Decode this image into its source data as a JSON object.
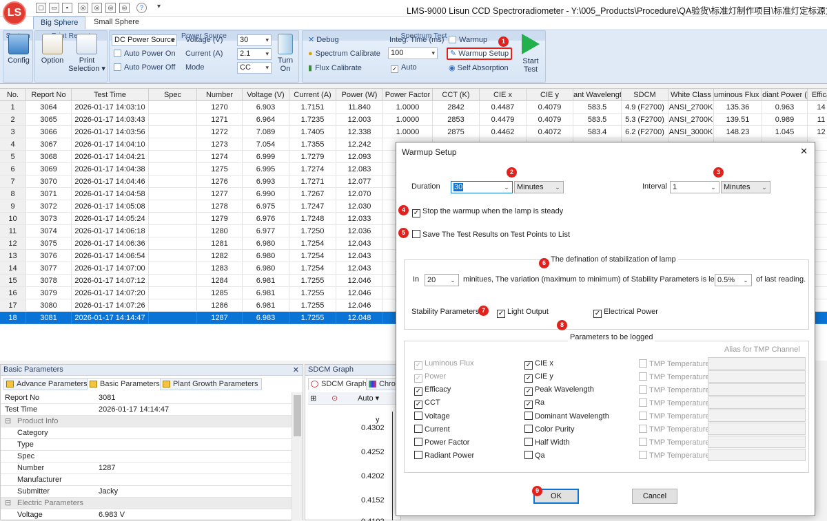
{
  "window": {
    "title": "LMS-9000 Lisun CCD Spectroradiometer - Y:\\005_Products\\Procedure\\QA验货\\标准灯制作项目\\标准灯定标源文件\\All",
    "logo_text": "LS"
  },
  "ribbon_tabs": [
    "Big Sphere",
    "Small Sphere"
  ],
  "ribbon": {
    "system": {
      "label": "System",
      "config": "Config"
    },
    "print_report": {
      "label": "Print Report",
      "option": "Option",
      "print": "Print",
      "selection": "Selection ▾"
    },
    "power_source": {
      "label": "Power Source",
      "source_select": "DC Power Source",
      "auto_on": "Auto Power On",
      "auto_off": "Auto Power Off",
      "voltage_label": "Voltage (V)",
      "voltage_value": "30",
      "current_label": "Current (A)",
      "current_value": "2.1",
      "mode_label": "Mode",
      "mode_value": "CC",
      "turn_on": "Turn",
      "turn_on2": "On"
    },
    "spectrum_test": {
      "label": "Spectrum Test",
      "debug": "Debug",
      "spectrum_calibrate": "Spectrum Calibrate",
      "flux_calibrate": "Flux Calibrate",
      "integ_label": "Integ. Time (ms)",
      "integ_value": "100",
      "auto": "Auto",
      "warmup": "Warmup",
      "warmup_setup": "Warmup Setup",
      "self_absorption": "Self Absorption",
      "start": "Start",
      "start2": "Test"
    }
  },
  "table": {
    "headers": [
      "No.",
      "Report No",
      "Test Time",
      "Spec",
      "Number",
      "Voltage (V)",
      "Current (A)",
      "Power (W)",
      "Power Factor",
      "CCT (K)",
      "CIE x",
      "CIE y",
      "ant Wavelengt",
      "SDCM",
      "White Class",
      "uminous Flux (l",
      "diant Power (",
      "Effica"
    ],
    "rows": [
      [
        "1",
        "3064",
        "2026-01-17 14:03:10",
        "",
        "1270",
        "6.903",
        "1.7151",
        "11.840",
        "1.0000",
        "2842",
        "0.4487",
        "0.4079",
        "583.5",
        "4.9 (F2700)",
        "ANSI_2700K",
        "135.36",
        "0.963",
        "14"
      ],
      [
        "2",
        "3065",
        "2026-01-17 14:03:43",
        "",
        "1271",
        "6.964",
        "1.7235",
        "12.003",
        "1.0000",
        "2853",
        "0.4479",
        "0.4079",
        "583.5",
        "5.3 (F2700)",
        "ANSI_2700K",
        "139.51",
        "0.989",
        "11"
      ],
      [
        "3",
        "3066",
        "2026-01-17 14:03:56",
        "",
        "1272",
        "7.089",
        "1.7405",
        "12.338",
        "1.0000",
        "2875",
        "0.4462",
        "0.4072",
        "583.4",
        "6.2 (F2700)",
        "ANSI_3000K",
        "148.23",
        "1.045",
        "12"
      ],
      [
        "4",
        "3067",
        "2026-01-17 14:04:10",
        "",
        "1273",
        "7.054",
        "1.7355",
        "12.242",
        "",
        "",
        "",
        "",
        "",
        "",
        "",
        "",
        "",
        ""
      ],
      [
        "5",
        "3068",
        "2026-01-17 14:04:21",
        "",
        "1274",
        "6.999",
        "1.7279",
        "12.093",
        "",
        "",
        "",
        "",
        "",
        "",
        "",
        "",
        "",
        ""
      ],
      [
        "6",
        "3069",
        "2026-01-17 14:04:38",
        "",
        "1275",
        "6.995",
        "1.7274",
        "12.083",
        "",
        "",
        "",
        "",
        "",
        "",
        "",
        "",
        "",
        ""
      ],
      [
        "7",
        "3070",
        "2026-01-17 14:04:46",
        "",
        "1276",
        "6.993",
        "1.7271",
        "12.077",
        "",
        "",
        "",
        "",
        "",
        "",
        "",
        "",
        "",
        ""
      ],
      [
        "8",
        "3071",
        "2026-01-17 14:04:58",
        "",
        "1277",
        "6.990",
        "1.7267",
        "12.070",
        "",
        "",
        "",
        "",
        "",
        "",
        "",
        "",
        "",
        ""
      ],
      [
        "9",
        "3072",
        "2026-01-17 14:05:08",
        "",
        "1278",
        "6.975",
        "1.7247",
        "12.030",
        "",
        "",
        "",
        "",
        "",
        "",
        "",
        "",
        "",
        ""
      ],
      [
        "10",
        "3073",
        "2026-01-17 14:05:24",
        "",
        "1279",
        "6.976",
        "1.7248",
        "12.033",
        "",
        "",
        "",
        "",
        "",
        "",
        "",
        "",
        "",
        ""
      ],
      [
        "11",
        "3074",
        "2026-01-17 14:06:18",
        "",
        "1280",
        "6.977",
        "1.7250",
        "12.036",
        "",
        "",
        "",
        "",
        "",
        "",
        "",
        "",
        "",
        ""
      ],
      [
        "12",
        "3075",
        "2026-01-17 14:06:36",
        "",
        "1281",
        "6.980",
        "1.7254",
        "12.043",
        "",
        "",
        "",
        "",
        "",
        "",
        "",
        "",
        "",
        ""
      ],
      [
        "13",
        "3076",
        "2026-01-17 14:06:54",
        "",
        "1282",
        "6.980",
        "1.7254",
        "12.043",
        "",
        "",
        "",
        "",
        "",
        "",
        "",
        "",
        "",
        ""
      ],
      [
        "14",
        "3077",
        "2026-01-17 14:07:00",
        "",
        "1283",
        "6.980",
        "1.7254",
        "12.043",
        "",
        "",
        "",
        "",
        "",
        "",
        "",
        "",
        "",
        ""
      ],
      [
        "15",
        "3078",
        "2026-01-17 14:07:12",
        "",
        "1284",
        "6.981",
        "1.7255",
        "12.046",
        "",
        "",
        "",
        "",
        "",
        "",
        "",
        "",
        "",
        ""
      ],
      [
        "16",
        "3079",
        "2026-01-17 14:07:20",
        "",
        "1285",
        "6.981",
        "1.7255",
        "12.046",
        "",
        "",
        "",
        "",
        "",
        "",
        "",
        "",
        "",
        ""
      ],
      [
        "17",
        "3080",
        "2026-01-17 14:07:26",
        "",
        "1286",
        "6.981",
        "1.7255",
        "12.046",
        "",
        "",
        "",
        "",
        "",
        "",
        "",
        "",
        "",
        ""
      ],
      [
        "18",
        "3081",
        "2026-01-17 14:14:47",
        "",
        "1287",
        "6.983",
        "1.7255",
        "12.048",
        "",
        "",
        "",
        "",
        "",
        "",
        "",
        "",
        "",
        ""
      ]
    ]
  },
  "basic_panel": {
    "title": "Basic Parameters",
    "close": "✕",
    "tabs": [
      "Advance Parameters",
      "Basic Parameters",
      "Plant Growth Parameters"
    ],
    "report_no_label": "Report No",
    "report_no": "3081",
    "test_time_label": "Test Time",
    "test_time": "2026-01-17 14:14:47",
    "product_info": "Product Info",
    "category": "Category",
    "type": "Type",
    "spec": "Spec",
    "number_label": "Number",
    "number": "1287",
    "manufacturer": "Manufacturer",
    "submitter_label": "Submitter",
    "submitter": "Jacky",
    "electric": "Electric Parameters",
    "voltage_label": "Voltage",
    "voltage": "6.983 V"
  },
  "sdcm_panel": {
    "title": "SDCM Graph",
    "tab1": "SDCM Graph",
    "tab2": "Chro",
    "auto": "Auto ▾",
    "axis_label": "y",
    "ticks": [
      "0.4302",
      "0.4252",
      "0.4202",
      "0.4152",
      "0.4102"
    ]
  },
  "dialog": {
    "title": "Warmup Setup",
    "close": "✕",
    "duration_label": "Duration",
    "duration_value": "30",
    "duration_unit": "Minutes",
    "interval_label": "Interval",
    "interval_value": "1",
    "interval_unit": "Minutes",
    "stop_when_steady": "Stop the warmup when the lamp is steady",
    "save_results": "Save The Test Results on Test Points to List",
    "stab_group": "The defination of stabilization of lamp",
    "in_label": "In",
    "in_value": "20",
    "stab_text": "minitues, The variation (maximum to minimum) of Stability Parameters is less than",
    "pct_value": "0.5%",
    "of_last": "of last reading.",
    "stab_params_label": "Stability Parameters",
    "light_output": "Light Output",
    "electrical_power": "Electrical Power",
    "log_group": "Parameters to be logged",
    "alias_header": "Alias for TMP Channel",
    "col1": [
      {
        "label": "Luminous Flux",
        "checked": true,
        "disabled": true
      },
      {
        "label": "Power",
        "checked": true,
        "disabled": true
      },
      {
        "label": "Efficacy",
        "checked": true,
        "disabled": false
      },
      {
        "label": "CCT",
        "checked": true,
        "disabled": false
      },
      {
        "label": "Voltage",
        "checked": false,
        "disabled": false
      },
      {
        "label": "Current",
        "checked": false,
        "disabled": false
      },
      {
        "label": "Power Factor",
        "checked": false,
        "disabled": false
      },
      {
        "label": "Radiant Power",
        "checked": false,
        "disabled": false
      }
    ],
    "col2": [
      {
        "label": "CIE x",
        "checked": true
      },
      {
        "label": "CIE y",
        "checked": true
      },
      {
        "label": "Peak Wavelength",
        "checked": true
      },
      {
        "label": "Ra",
        "checked": true
      },
      {
        "label": "Dominant Wavelength",
        "checked": false
      },
      {
        "label": "Color Purity",
        "checked": false
      },
      {
        "label": "Half Width",
        "checked": false
      },
      {
        "label": "Qa",
        "checked": false
      }
    ],
    "tmp_label": "TMP Temperature",
    "ok": "OK",
    "cancel": "Cancel"
  },
  "badges": [
    "1",
    "2",
    "3",
    "4",
    "5",
    "6",
    "7",
    "8",
    "9"
  ],
  "colors": {
    "accent": "#0a74d6",
    "badge": "#e2211c",
    "ribbon": "#dfeaf6"
  }
}
